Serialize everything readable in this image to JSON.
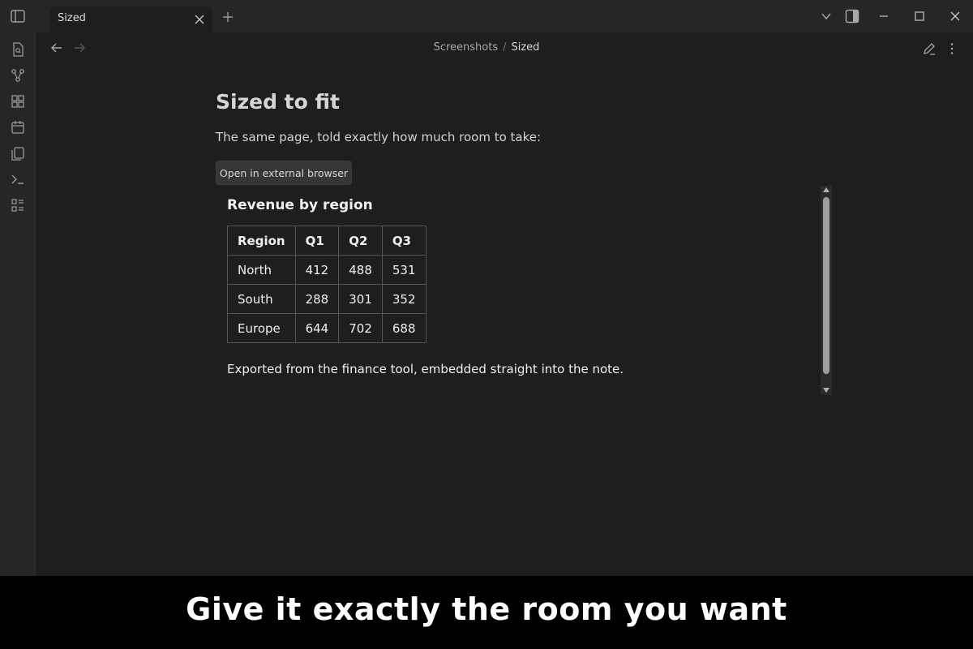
{
  "tab": {
    "title": "Sized"
  },
  "breadcrumb": {
    "parent": "Screenshots",
    "separator": "/",
    "current": "Sized"
  },
  "note": {
    "title": "Sized to fit",
    "paragraph": "The same page, told exactly how much room to take:",
    "button_label": "Open in external browser"
  },
  "embed": {
    "heading": "Revenue by region",
    "table": {
      "headers": [
        "Region",
        "Q1",
        "Q2",
        "Q3"
      ],
      "rows": [
        [
          "North",
          "412",
          "488",
          "531"
        ],
        [
          "South",
          "288",
          "301",
          "352"
        ],
        [
          "Europe",
          "644",
          "702",
          "688"
        ]
      ]
    },
    "footer": "Exported from the finance tool, embedded straight into the note."
  },
  "caption": "Give it exactly the room you want",
  "colors": {
    "background": "#1e1e1e",
    "chrome": "#262626",
    "caption_bar": "#000000"
  },
  "icons": {
    "ribbon": [
      "file-search-icon",
      "graph-icon",
      "grid-icon",
      "calendar-icon",
      "copy-icon",
      "terminal-icon",
      "list-icon"
    ]
  }
}
